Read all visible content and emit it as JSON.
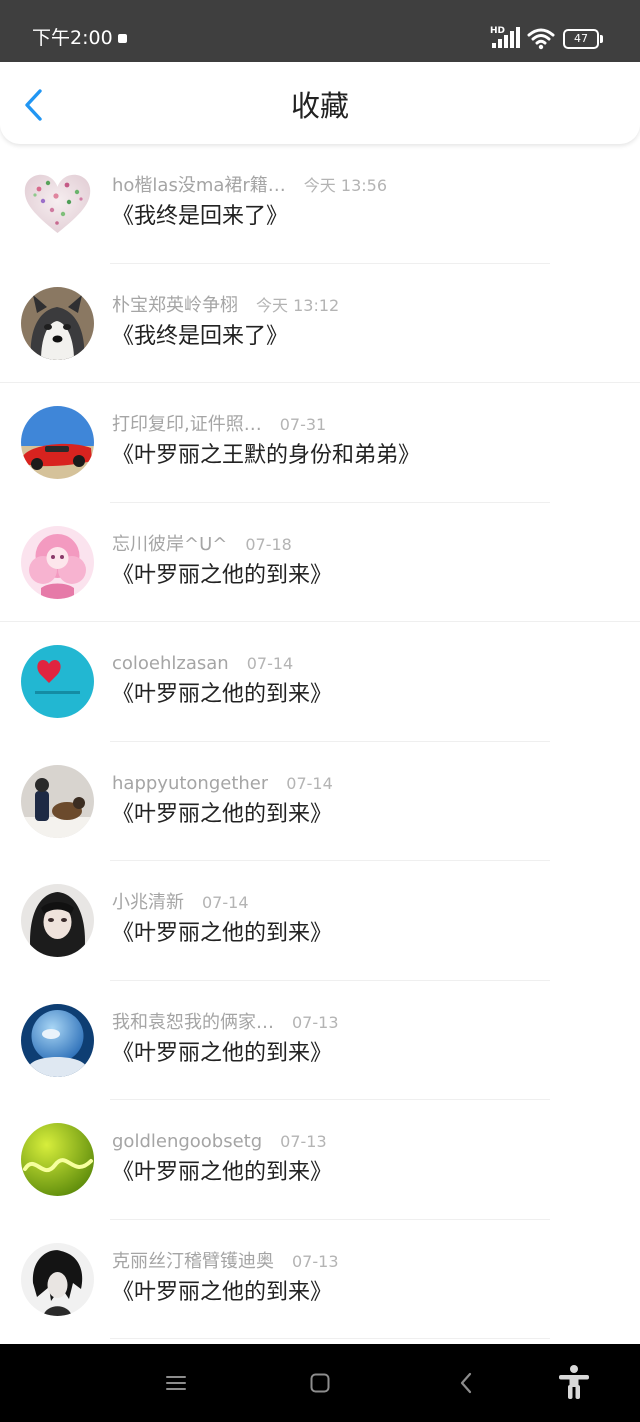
{
  "status": {
    "time": "下午2:00",
    "network": "HD",
    "battery": "47"
  },
  "header": {
    "title": "收藏"
  },
  "items": [
    {
      "user": "ho楷las没ma裙r籍…",
      "date": "今天 13:56",
      "story": "《我终是回来了》",
      "avatar": "heart"
    },
    {
      "user": "朴宝郑英岭争栩",
      "date": "今天 13:12",
      "story": "《我终是回来了》",
      "avatar": "dog"
    },
    {
      "user": "打印复印,证件照…",
      "date": "07-31",
      "story": "《叶罗丽之王默的身份和弟弟》",
      "avatar": "car"
    },
    {
      "user": "忘川彼岸^U^",
      "date": "07-18",
      "story": "《叶罗丽之他的到来》",
      "avatar": "doll"
    },
    {
      "user": "coloehlzasan",
      "date": "07-14",
      "story": "《叶罗丽之他的到来》",
      "avatar": "cyan"
    },
    {
      "user": "happyutongether",
      "date": "07-14",
      "story": "《叶罗丽之他的到来》",
      "avatar": "snow"
    },
    {
      "user": "小兆清新",
      "date": "07-14",
      "story": "《叶罗丽之他的到来》",
      "avatar": "girl"
    },
    {
      "user": "我和袁恕我的俩家…",
      "date": "07-13",
      "story": "《叶罗丽之他的到来》",
      "avatar": "globe"
    },
    {
      "user": "goldlengoobsetg",
      "date": "07-13",
      "story": "《叶罗丽之他的到来》",
      "avatar": "lime"
    },
    {
      "user": "克丽丝汀稽臂镬迪奥",
      "date": "07-13",
      "story": "《叶罗丽之他的到来》",
      "avatar": "sketch"
    }
  ],
  "colors": {
    "status_bar": "#3f3f3f",
    "accent": "#2196f3",
    "title": "#222222",
    "meta": "#a5a5a5",
    "nav_bar": "#000000"
  }
}
